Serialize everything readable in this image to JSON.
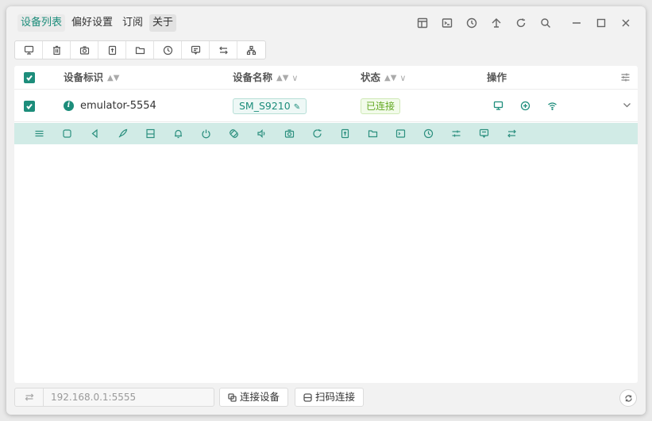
{
  "nav": {
    "tabs": [
      {
        "label": "设备列表"
      },
      {
        "label": "偏好设置"
      },
      {
        "label": "订阅"
      },
      {
        "label": "关于"
      }
    ]
  },
  "title_actions": [
    "layout-icon",
    "terminal-icon",
    "history-icon",
    "pin-icon",
    "refresh-icon",
    "search-icon",
    "minimize-icon",
    "maximize-icon",
    "close-icon"
  ],
  "toolbar": [
    "device-icon",
    "trash-icon",
    "camera-icon",
    "upload-file-icon",
    "folder-icon",
    "clock-icon",
    "message-icon",
    "swap-icon",
    "network-icon"
  ],
  "table": {
    "columns": {
      "serial": "设备标识",
      "name": "设备名称",
      "status": "状态",
      "actions": "操作"
    },
    "rows": [
      {
        "serial": "emulator-5554",
        "name": "SM_S9210",
        "status": "已连接"
      }
    ]
  },
  "control_bar": [
    "menu-icon",
    "home-icon",
    "back-icon",
    "rocket-icon",
    "keyboard-icon",
    "notification-icon",
    "power-icon",
    "rotate-icon",
    "volume-icon",
    "screenshot-icon",
    "reboot-icon",
    "upload-icon",
    "folder-icon",
    "terminal-icon",
    "clock-icon",
    "settings-icon",
    "message-icon",
    "swap-icon"
  ],
  "bottom": {
    "address_value": "192.168.0.1:5555",
    "connect_label": "连接设备",
    "scan_label": "扫码连接"
  },
  "colors": {
    "accent": "#1d8d7b",
    "control_bar_bg": "#d1ebe6",
    "status_green": "#62a822"
  }
}
